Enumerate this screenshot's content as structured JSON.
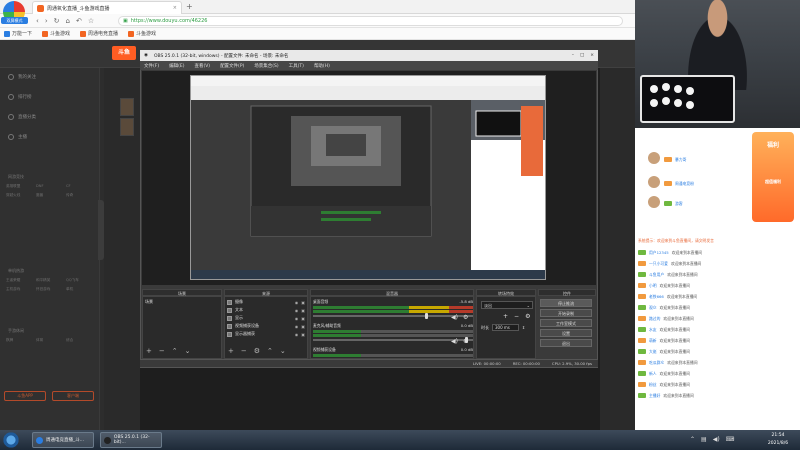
{
  "browser": {
    "badge": "双屏模式",
    "tab_title": "周通氧化直播_斗鱼游戏直播",
    "url_scheme": "https://",
    "url_host": "www.douyu.com/",
    "url_path": "46226",
    "bookmarks": [
      "万能一下",
      "斗鱼游戏",
      "周通电竞直播",
      "斗鱼游戏"
    ]
  },
  "douyu": {
    "logo": "斗鱼",
    "nav": [
      "我的关注",
      "排行榜",
      "直播分类",
      "主播"
    ],
    "sections": [
      "网游竞技",
      "单机热游",
      "手游休闲"
    ],
    "grid": [
      "英雄联盟",
      "DNF",
      "CF",
      "穿越火线",
      "魔兽",
      "传奇",
      "王者荣耀",
      "和平精英",
      "QQ飞车",
      "主机游戏",
      "怀旧游戏",
      "单机",
      "棋牌",
      "体育",
      "综合"
    ],
    "btn_left": "斗鱼APP",
    "btn_right": "客户端"
  },
  "obs": {
    "title": "OBS 25.0.1 (32-bit, windows) - 配置文件: 未命名 - 场景: 未命名",
    "menu": [
      "文件(F)",
      "编辑(E)",
      "查看(V)",
      "配置文件(P)",
      "场景集合(S)",
      "工具(T)",
      "帮助(H)"
    ],
    "panels": {
      "scenes": "场景",
      "sources": "来源",
      "mixer": "混音器",
      "transitions": "转场特效",
      "controls": "控件"
    },
    "scene_item": "场景",
    "sources": [
      "摄像",
      "文本",
      "显示",
      "视频捕获设备",
      "显示器捕获"
    ],
    "mixer": [
      {
        "name": "桌面音频",
        "db": "-5.8 dB"
      },
      {
        "name": "麦克风/辅助音频",
        "db": "0.0 dB"
      },
      {
        "name": "视频捕获设备",
        "db": "0.0 dB"
      }
    ],
    "transition": "淡出",
    "duration_label": "时长",
    "duration_value": "300 ms",
    "controls": [
      "停止推流",
      "开始录制",
      "工作室模式",
      "设置",
      "退出"
    ],
    "status": {
      "live": "LIVE: 00:00:00",
      "rec": "REC: 00:00:00",
      "cpu": "CPU: 2.9%, 30.00 fps"
    }
  },
  "chat": {
    "gift_banner": "福利",
    "gift_sub": "超值福利",
    "rows": [
      {
        "user": "暴力哥",
        "text": "欢迎来到本直播间"
      },
      {
        "user": "周通电竞粉",
        "text": "欢迎来到本直播间"
      },
      {
        "user": "游客",
        "text": "欢迎来到本直播间"
      },
      {
        "user": "用户12345",
        "text": "欢迎来到本直播间"
      },
      {
        "user": "一只小可爱",
        "text": "欢迎来到本直播间"
      },
      {
        "user": "斗鱼用户",
        "text": "欢迎来到本直播间"
      },
      {
        "user": "小明",
        "text": "欢迎来到本直播间"
      },
      {
        "user": "老铁666",
        "text": "欢迎来到本直播间"
      },
      {
        "user": "观众",
        "text": "欢迎来到本直播间"
      },
      {
        "user": "路过的",
        "text": "欢迎来到本直播间"
      },
      {
        "user": "水友",
        "text": "欢迎来到本直播间"
      },
      {
        "user": "萌新",
        "text": "欢迎来到本直播间"
      },
      {
        "user": "大佬",
        "text": "欢迎来到本直播间"
      },
      {
        "user": "吃瓜群众",
        "text": "欢迎来到本直播间"
      },
      {
        "user": "新人",
        "text": "欢迎来到本直播间"
      },
      {
        "user": "粉丝",
        "text": "欢迎来到本直播间"
      },
      {
        "user": "主播好",
        "text": "欢迎来到本直播间"
      }
    ],
    "notice": "系统提示：欢迎来到斗鱼直播间，请文明发言"
  },
  "taskbar": {
    "tasks": [
      "周通电竞直播_斗...",
      "OBS 25.0.1 (32-bit)..."
    ],
    "time": "21:54",
    "date": "2021/8/6"
  },
  "colors": {
    "douyu_orange": "#ff5d23",
    "obs_bg": "#3a3a3a",
    "url_green": "#2e9e44"
  }
}
